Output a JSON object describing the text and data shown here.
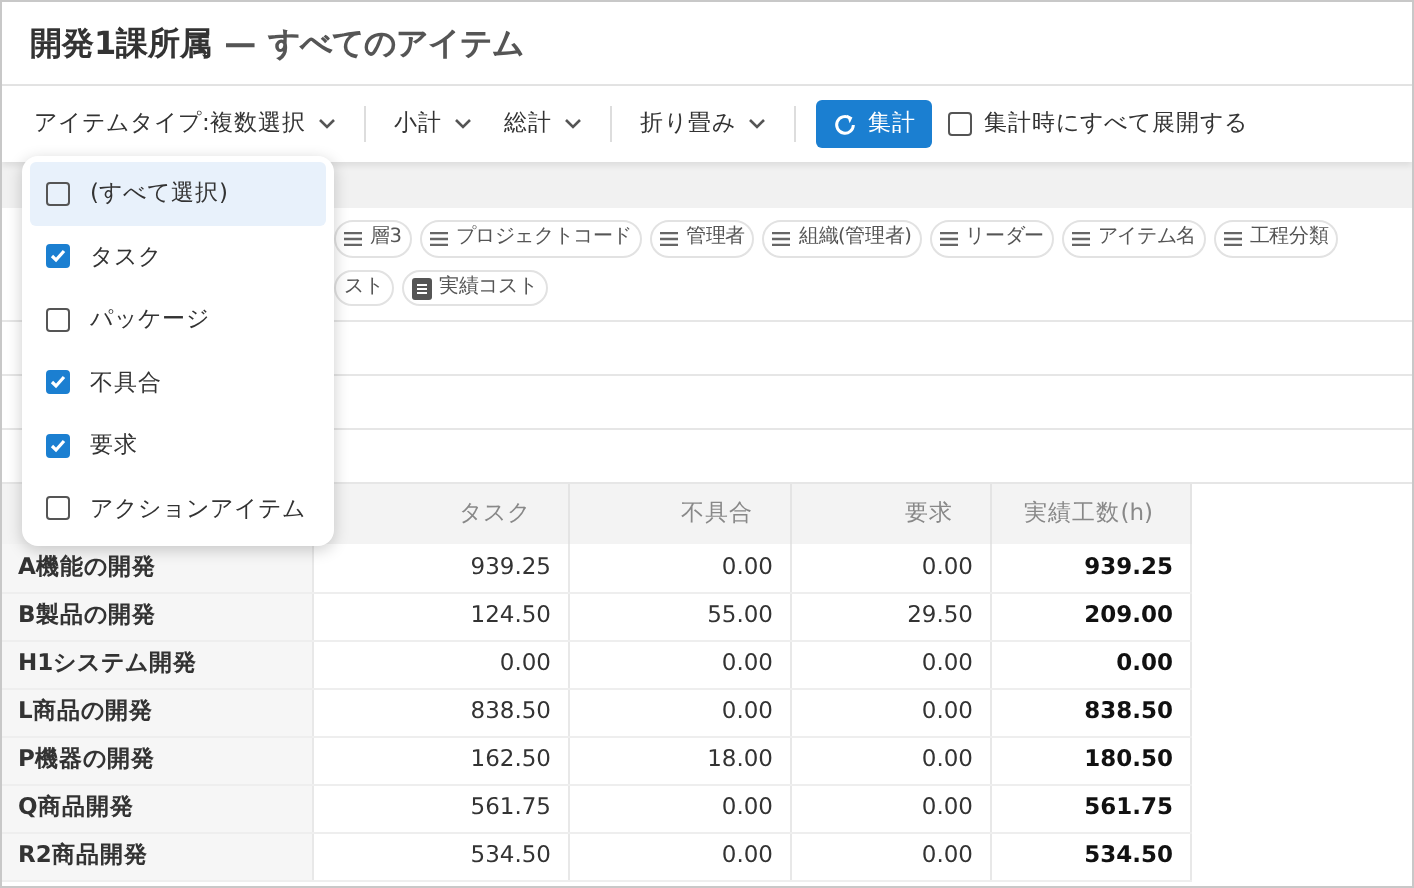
{
  "title": {
    "main": "開発1課所属",
    "separator": "—",
    "sub": "すべてのアイテム"
  },
  "toolbar": {
    "items": [
      {
        "kind": "dropdown",
        "label": "アイテムタイプ:複数選択"
      },
      {
        "kind": "divider"
      },
      {
        "kind": "dropdown",
        "label": "小計"
      },
      {
        "kind": "dropdown",
        "label": "総計"
      },
      {
        "kind": "divider"
      },
      {
        "kind": "dropdown",
        "label": "折り畳み"
      },
      {
        "kind": "divider"
      },
      {
        "kind": "primary",
        "label": "集計"
      },
      {
        "kind": "checkbox",
        "label": "集計時にすべて展開する",
        "checked": false
      }
    ]
  },
  "chips": [
    [
      {
        "label": "層3",
        "kind": "field"
      },
      {
        "label": "プロジェクトコード",
        "kind": "field"
      },
      {
        "label": "管理者",
        "kind": "field"
      },
      {
        "label": "組織(管理者)",
        "kind": "field"
      },
      {
        "label": "リーダー",
        "kind": "field"
      },
      {
        "label": "アイテム名",
        "kind": "field"
      },
      {
        "label": "工程分類",
        "kind": "field"
      }
    ],
    [
      {
        "label": "スト",
        "kind": "cut"
      },
      {
        "label": "実績コスト",
        "kind": "value"
      }
    ]
  ],
  "type_menu": [
    {
      "label": "(すべて選択)",
      "checked": false,
      "selected": true
    },
    {
      "label": "タスク",
      "checked": true,
      "selected": false
    },
    {
      "label": "パッケージ",
      "checked": false,
      "selected": false
    },
    {
      "label": "不具合",
      "checked": true,
      "selected": false
    },
    {
      "label": "要求",
      "checked": true,
      "selected": false
    },
    {
      "label": "アクションアイテム",
      "checked": false,
      "selected": false
    }
  ],
  "table": {
    "columns": [
      "タスク",
      "不具合",
      "要求",
      "実績工数(h)"
    ],
    "rows": [
      {
        "name": "A機能の開発",
        "cells": [
          "939.25",
          "0.00",
          "0.00",
          "939.25"
        ]
      },
      {
        "name": "B製品の開発",
        "cells": [
          "124.50",
          "55.00",
          "29.50",
          "209.00"
        ]
      },
      {
        "name": "H1システム開発",
        "cells": [
          "0.00",
          "0.00",
          "0.00",
          "0.00"
        ]
      },
      {
        "name": "L商品の開発",
        "cells": [
          "838.50",
          "0.00",
          "0.00",
          "838.50"
        ]
      },
      {
        "name": "P機器の開発",
        "cells": [
          "162.50",
          "18.00",
          "0.00",
          "180.50"
        ]
      },
      {
        "name": "Q商品開発",
        "cells": [
          "561.75",
          "0.00",
          "0.00",
          "561.75"
        ]
      },
      {
        "name": "R2商品開発",
        "cells": [
          "534.50",
          "0.00",
          "0.00",
          "534.50"
        ]
      }
    ]
  }
}
